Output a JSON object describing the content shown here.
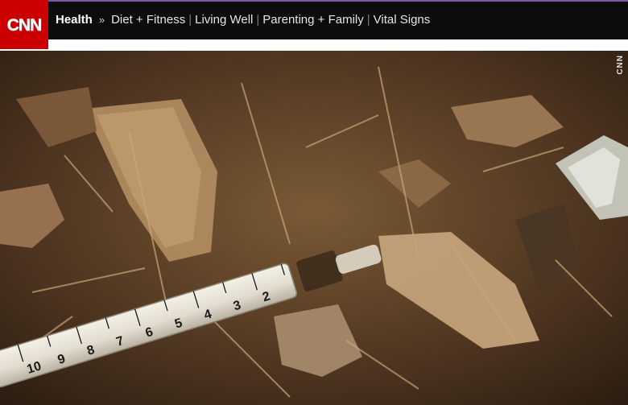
{
  "header": {
    "logo_text": "CNN",
    "logo_color": "#cc0000",
    "bar_color": "#0c0c0c",
    "accent_color": "#7a5aa8"
  },
  "nav": {
    "section": "Health",
    "separator": "»",
    "links": [
      "Diet + Fitness",
      "Living Well",
      "Parenting + Family",
      "Vital Signs"
    ]
  },
  "hero": {
    "watermark": "CNN",
    "syringe_markings": [
      "10",
      "9",
      "8",
      "7",
      "6",
      "5",
      "4",
      "3",
      "2"
    ]
  }
}
